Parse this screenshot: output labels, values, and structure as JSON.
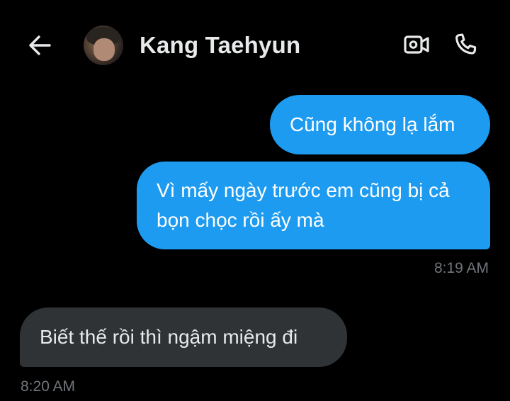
{
  "header": {
    "back_icon": "arrow-left-icon",
    "contact_name": "Kang Taehyun",
    "video_icon": "video-camera-icon",
    "call_icon": "phone-icon"
  },
  "messages": [
    {
      "direction": "sent",
      "text": "Cũng không lạ lắm"
    },
    {
      "direction": "sent",
      "text": "Vì mấy ngày trước em cũng bị cả\nbọn chọc rồi ấy mà",
      "time": "8:19 AM"
    },
    {
      "direction": "received",
      "text": "Biết thế rồi thì ngậm miệng đi",
      "time": "8:20 AM"
    }
  ],
  "colors": {
    "background": "#000000",
    "sent_bubble": "#1d9bf0",
    "received_bubble": "#2f3336",
    "timestamp": "#71767b",
    "text": "#e7e9ea"
  }
}
